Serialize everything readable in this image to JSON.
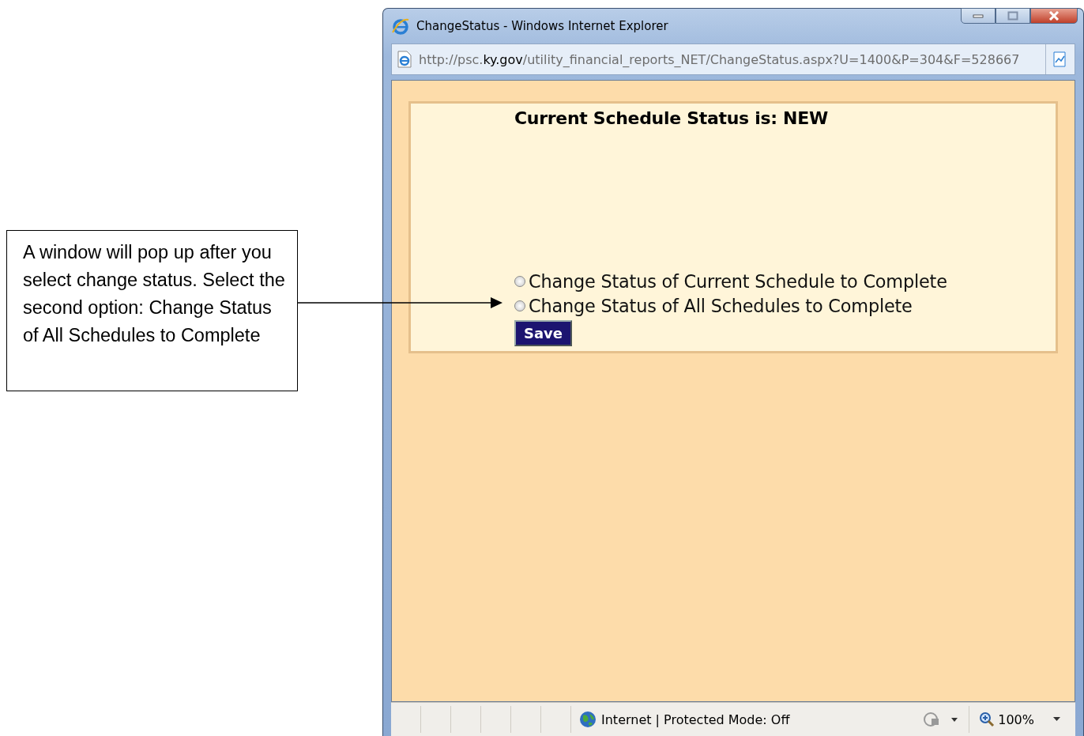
{
  "callout": {
    "text": "A window will pop up after you select change status. Select the second option: Change Status of All Schedules to Complete"
  },
  "window": {
    "title": "ChangeStatus - Windows Internet Explorer",
    "address": "http://psc.**ky.gov**/utility_financial_reports_NET/ChangeStatus.aspx?U=1400&P=304&F=528667"
  },
  "page": {
    "heading": "Current Schedule Status is: NEW",
    "options": [
      {
        "label": "Change Status of Current Schedule to Complete",
        "selected": false
      },
      {
        "label": "Change Status of All Schedules to Complete",
        "selected": false
      }
    ],
    "save_button": "Save"
  },
  "status_bar": {
    "zone": "Internet | Protected Mode: Off",
    "zoom": "100%"
  }
}
